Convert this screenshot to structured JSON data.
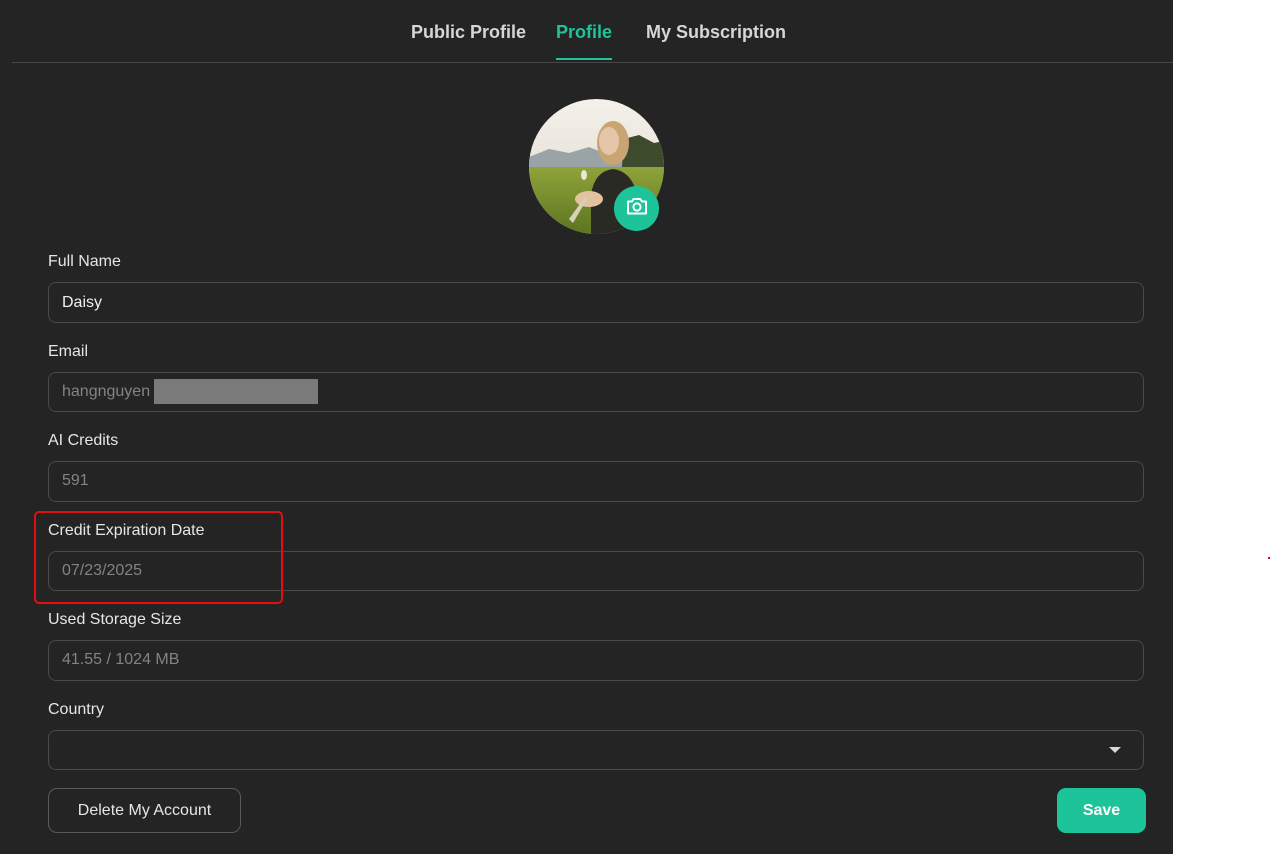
{
  "tabs": [
    {
      "label": "Public Profile",
      "active": false
    },
    {
      "label": "Profile",
      "active": true
    },
    {
      "label": "My Subscription",
      "active": false
    }
  ],
  "avatar": {
    "icon": "camera-icon"
  },
  "fields": {
    "full_name": {
      "label": "Full Name",
      "value": "Daisy"
    },
    "email": {
      "label": "Email",
      "value": "hangnguyen"
    },
    "ai_credits": {
      "label": "AI Credits",
      "value": "591"
    },
    "credit_expiration": {
      "label": "Credit Expiration Date",
      "value": "07/23/2025"
    },
    "used_storage": {
      "label": "Used Storage Size",
      "value": "41.55 / 1024 MB"
    },
    "country": {
      "label": "Country",
      "value": ""
    }
  },
  "buttons": {
    "delete_label": "Delete My Account",
    "save_label": "Save"
  },
  "colors": {
    "accent": "#1dc49a",
    "background": "#242424",
    "highlight": "#e01010"
  }
}
